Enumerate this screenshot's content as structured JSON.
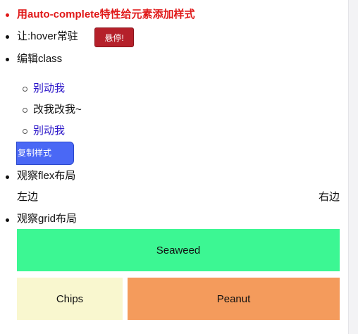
{
  "items": {
    "autocomplete_title": "用auto-complete特性给元素添加样式",
    "hover_label": "让:hover常驻",
    "hover_button": "悬停!",
    "edit_class_label": "编辑class",
    "sub_items": [
      "别动我",
      "改我改我~",
      "别动我"
    ],
    "copy_button": "复制样式",
    "flex_label": "观察flex布局",
    "flex_left": "左边",
    "flex_right": "右边",
    "grid_label": "观察grid布局"
  },
  "grid": {
    "cells": [
      "Seaweed",
      "Chips",
      "Peanut"
    ],
    "colors": {
      "seaweed": "#3cf793",
      "chips": "#f9f7cf",
      "peanut": "#f49b5c"
    }
  },
  "colors": {
    "title_red": "#e01818",
    "link_blue": "#2a14c8",
    "hover_btn": "#b5202a",
    "copy_btn": "#4a68f5"
  }
}
